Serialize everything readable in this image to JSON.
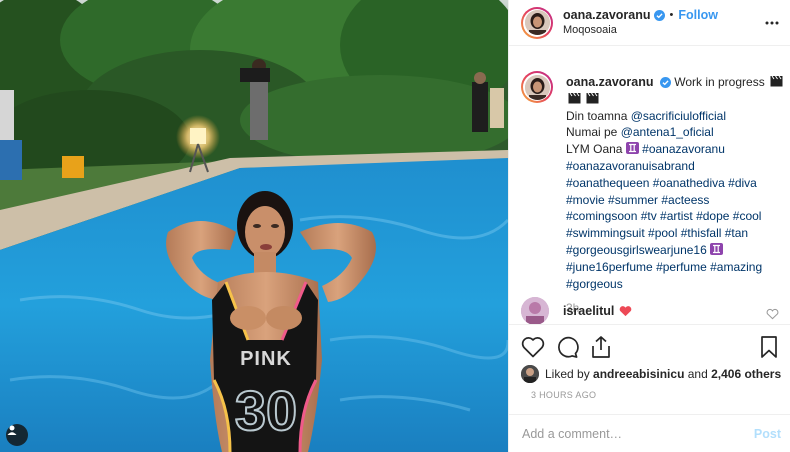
{
  "post": {
    "username": "oana.zavoranu",
    "verified": true,
    "separator": "•",
    "follow_label": "Follow",
    "location": "Moqosoaia",
    "more_icon": "more-horizontal-icon"
  },
  "caption": {
    "username": "oana.zavoranu",
    "lines": [
      {
        "type": "text",
        "value": "Work in progress"
      },
      {
        "type": "text",
        "value": "Din toamna "
      },
      {
        "type": "mention",
        "value": "@sacrificiulofficial"
      },
      {
        "type": "text",
        "value": "Numai pe "
      },
      {
        "type": "mention",
        "value": "@antena1_oficial"
      },
      {
        "type": "text",
        "value": "LYM Oana "
      },
      {
        "type": "hashtag",
        "value": "#oanazavoranu"
      },
      {
        "type": "hashtag",
        "value": "#oanazavoranuisabrand"
      },
      {
        "type": "hashtag",
        "value": "#oanathequeen #oanathediva #diva"
      },
      {
        "type": "hashtag",
        "value": "#movie #summer #acteess"
      },
      {
        "type": "hashtag",
        "value": "#comingsoon #tv #artist #dope #cool"
      },
      {
        "type": "hashtag",
        "value": "#swimmingsuit #pool #thisfall #tan"
      },
      {
        "type": "hashtag",
        "value": "#gorgeousgirlswearjune16"
      },
      {
        "type": "hashtag",
        "value": "#june16perfume #perfume #amazing"
      },
      {
        "type": "hashtag",
        "value": "#gorgeous"
      }
    ],
    "first_line": "Work in progress",
    "din_prefix": "Din toamna ",
    "din_mention": "@sacrificiulofficial",
    "numai_prefix": "Numai pe ",
    "numai_mention": "@antena1_oficial",
    "lym_prefix": "LYM Oana ",
    "lym_tag": "#oanazavoranu",
    "tags_1": "#oanazavoranuisabrand",
    "tags_2": "#oanathequeen #oanathediva #diva",
    "tags_3": "#movie #summer #acteess",
    "tags_4": "#comingsoon #tv #artist #dope #cool",
    "tags_5": "#swimmingsuit #pool #thisfall #tan",
    "tags_6": "#gorgeousgirlswearjune16",
    "tags_7": "#june16perfume #perfume #amazing",
    "tags_8": "#gorgeous",
    "time_ago": "3h",
    "emojis": [
      "clapper-board-icon",
      "clapper-board-icon",
      "clapper-board-icon",
      "gemini-icon",
      "gemini-icon"
    ]
  },
  "comment": {
    "username": "israelitul",
    "emoji": "red-heart-icon"
  },
  "actions": {
    "like_icon": "heart-icon",
    "comment_icon": "comment-icon",
    "share_icon": "share-icon",
    "save_icon": "bookmark-icon"
  },
  "likes": {
    "prefix": "Liked by ",
    "user": "andreeabisinicu",
    "middle": " and ",
    "count": "2,406 others"
  },
  "timestamp": "3 hours ago",
  "add_comment": {
    "placeholder": "Add a comment…",
    "post_label": "Post"
  },
  "colors": {
    "link": "#003569",
    "follow": "#3897f0",
    "muted": "#999999",
    "border": "#efefef",
    "heart": "#ed4956"
  },
  "photo": {
    "swimsuit_print": "PINK",
    "swimsuit_number": "30",
    "user_tag_icon": "user-tag-icon"
  }
}
